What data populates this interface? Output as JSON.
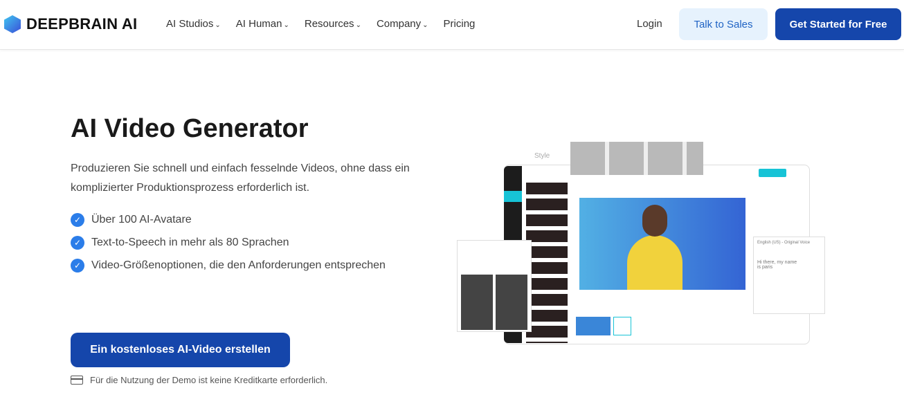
{
  "nav": {
    "brand": "DEEPBRAIN AI",
    "menu": [
      {
        "label": "AI Studios"
      },
      {
        "label": "AI Human"
      },
      {
        "label": "Resources"
      },
      {
        "label": "Company"
      },
      {
        "label": "Pricing"
      }
    ],
    "login": "Login",
    "talk_to_sales": "Talk to Sales",
    "get_started": "Get Started for Free"
  },
  "hero": {
    "title": "AI Video Generator",
    "description": "Produzieren Sie schnell und einfach fesselnde Videos, ohne dass ein komplizierter Produktionsprozess erforderlich ist.",
    "features": [
      "Über 100 AI-Avatare",
      "Text-to-Speech in mehr als 80 Sprachen",
      "Video-Größenoptionen, die den Anforderungen entsprechen"
    ],
    "cta": "Ein kostenloses AI-Video erstellen",
    "note": "Für die Nutzung der Demo ist keine Kreditkarte erforderlich."
  },
  "illustration": {
    "style_label": "Style",
    "voice": "English (US) - Original Voice",
    "script": "Hi there, my name is paris",
    "accent": "#17c3d6"
  }
}
